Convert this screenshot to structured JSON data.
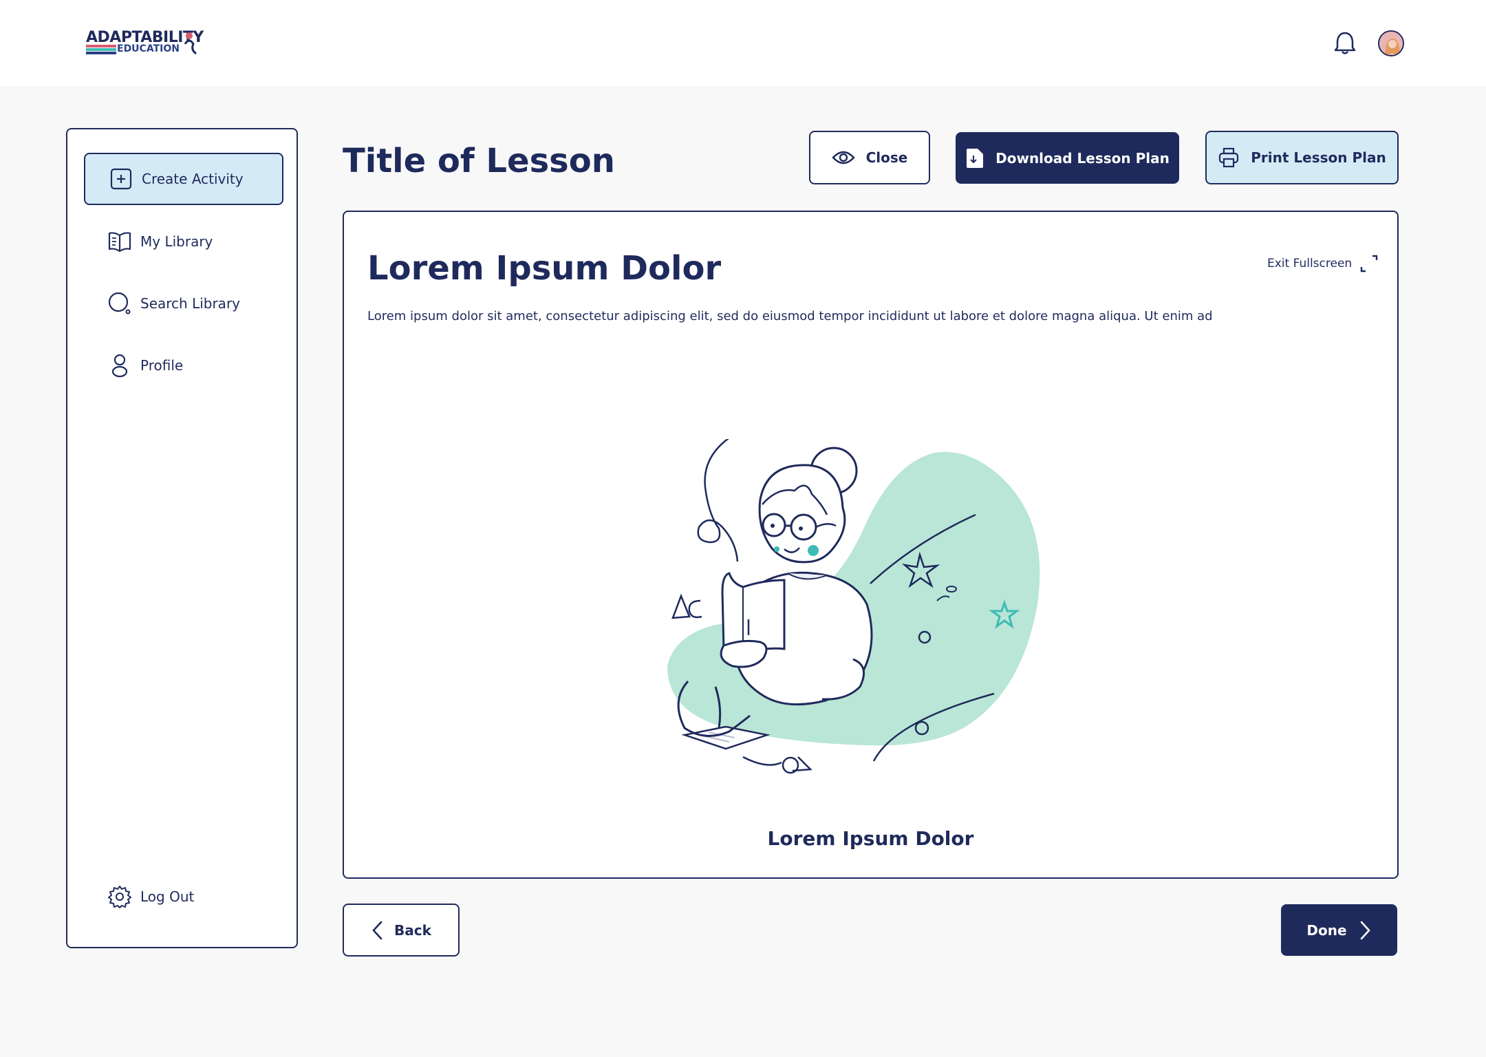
{
  "header": {
    "logo_line1": "ADAPTABILITY",
    "logo_line2": "EDUCATION",
    "notification_icon": "bell-icon",
    "avatar_icon": "user-avatar"
  },
  "sidebar": {
    "items": [
      {
        "label": "Create Activity",
        "icon": "plus-square-icon",
        "active": true
      },
      {
        "label": "My Library",
        "icon": "book-icon"
      },
      {
        "label": "Search Library",
        "icon": "search-icon"
      },
      {
        "label": "Profile",
        "icon": "user-icon"
      }
    ],
    "logout": {
      "label": "Log Out",
      "icon": "gear-icon"
    }
  },
  "page": {
    "title": "Title of Lesson"
  },
  "toolbar": {
    "close_label": "Close",
    "download_label": "Download Lesson Plan",
    "print_label": "Print Lesson Plan"
  },
  "content": {
    "heading": "Lorem Ipsum Dolor",
    "exit_fullscreen_label": "Exit Fullscreen",
    "paragraph": "Lorem ipsum dolor sit amet, consectetur adipiscing elit, sed do eiusmod tempor incididunt ut labore et dolore magna aliqua. Ut enim ad",
    "illustration": "girl-reading-illustration",
    "caption": "Lorem Ipsum Dolor"
  },
  "footer_nav": {
    "back_label": "Back",
    "done_label": "Done"
  },
  "colors": {
    "primary": "#1f2a5c",
    "accent_light": "#d4ebf6",
    "mint": "#b9e6d6",
    "teal": "#3cbcb4",
    "background": "#f8f8f8"
  }
}
